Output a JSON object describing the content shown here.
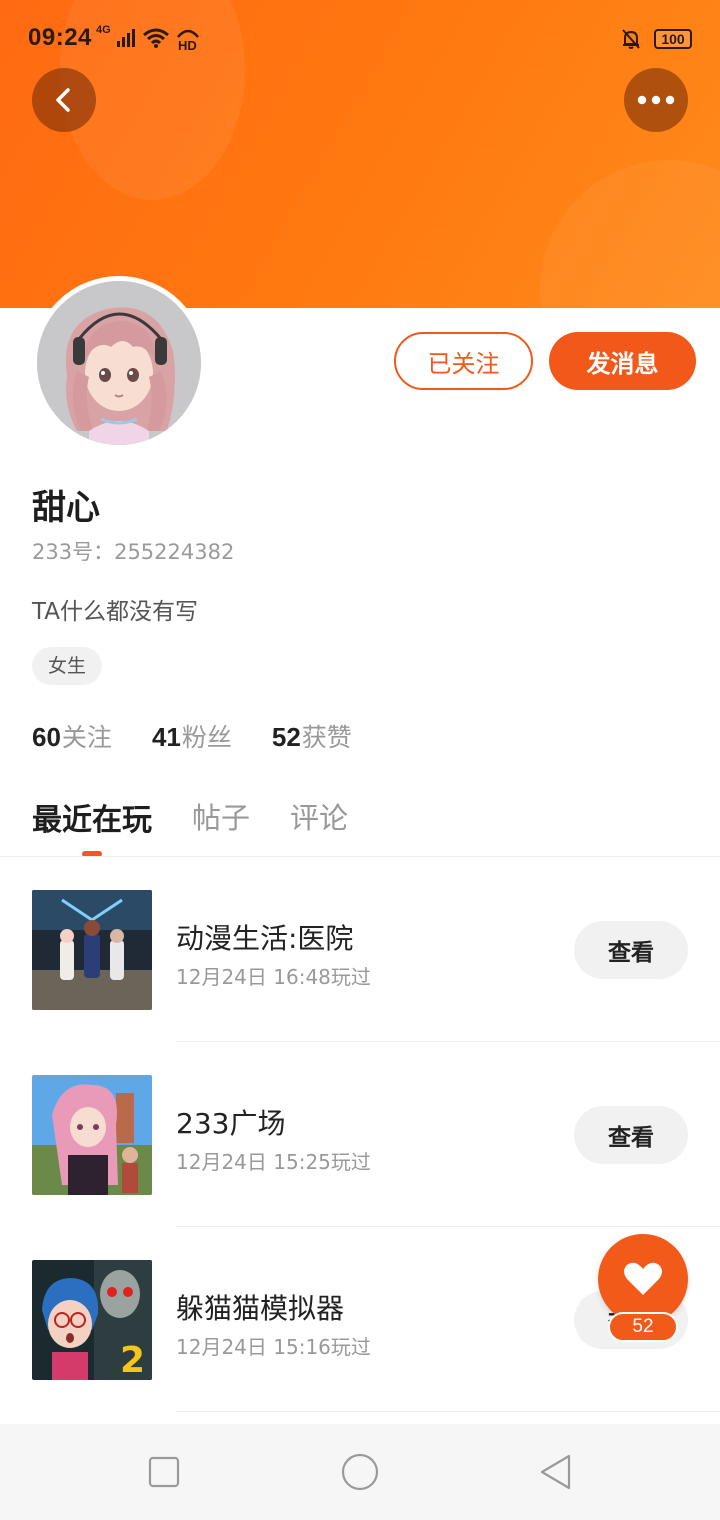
{
  "status_bar": {
    "time": "09:24",
    "network": "4G",
    "battery": "100",
    "icons": [
      "signal-icon",
      "wifi-icon",
      "hd-icon",
      "mute-bell-icon",
      "battery-icon"
    ]
  },
  "header": {
    "accent_color": "#f2581a",
    "back_icon": "chevron-left-icon",
    "more_icon": "more-horizontal-icon"
  },
  "profile": {
    "name": "甜心",
    "uid": "233号：255224382",
    "bio": "TA什么都没有写",
    "gender_tag": "女生",
    "followed_label": "已关注",
    "message_label": "发消息",
    "stats": {
      "following_count": "60",
      "following_label": "关注",
      "fans_count": "41",
      "fans_label": "粉丝",
      "likes_count": "52",
      "likes_label": "获赞"
    }
  },
  "tabs": [
    {
      "label": "最近在玩",
      "active": true
    },
    {
      "label": "帖子",
      "active": false
    },
    {
      "label": "评论",
      "active": false
    }
  ],
  "games": [
    {
      "title": "动漫生活:医院",
      "time": "12月24日 16:48玩过",
      "button": "查看"
    },
    {
      "title": "233广场",
      "time": "12月24日 15:25玩过",
      "button": "查看"
    },
    {
      "title": "躲猫猫模拟器",
      "time": "12月24日 15:16玩过",
      "button": "查看"
    }
  ],
  "like_fab": {
    "icon": "heart-icon",
    "count": "52"
  },
  "nav_bar": {
    "icons": [
      "recents-square-icon",
      "home-circle-icon",
      "back-triangle-icon"
    ]
  }
}
